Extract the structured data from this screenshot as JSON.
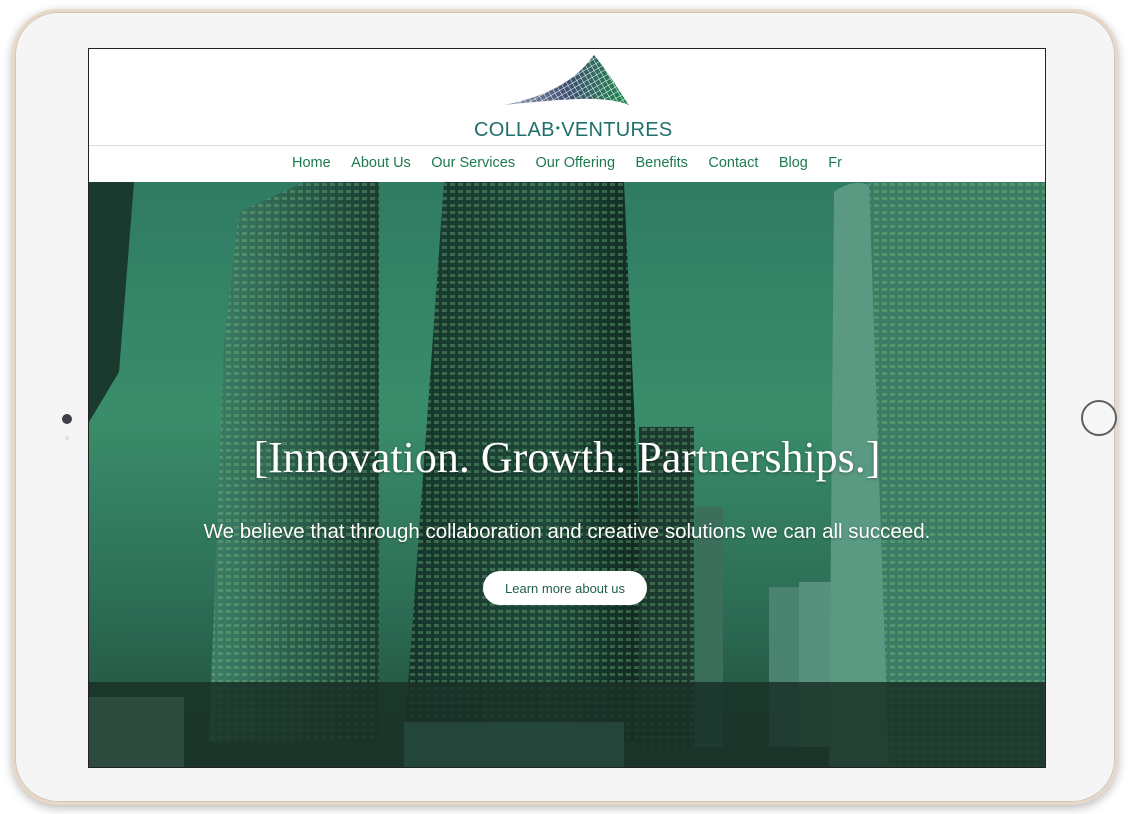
{
  "brand": {
    "name_left": "COLLAB",
    "separator": "•",
    "name_right": "VENTURES"
  },
  "nav": {
    "items": [
      {
        "label": "Home"
      },
      {
        "label": "About Us"
      },
      {
        "label": "Our Services"
      },
      {
        "label": "Our Offering"
      },
      {
        "label": "Benefits"
      },
      {
        "label": "Contact"
      },
      {
        "label": "Blog"
      },
      {
        "label": "Fr"
      }
    ]
  },
  "hero": {
    "headline": "[Innovation. Growth. Partnerships.]",
    "tagline": "We believe that through collaboration and creative solutions we can all succeed.",
    "cta_label": "Learn more about us"
  },
  "colors": {
    "brand_green": "#1d7a4e",
    "hero_tint": "#2f7b63",
    "device_frame": "#f5f5f6",
    "device_bezel_gold": "#e8d8c7"
  },
  "icons": {
    "logo": "mesh-roof-logo-icon",
    "camera": "camera-icon",
    "home": "home-button-icon"
  }
}
